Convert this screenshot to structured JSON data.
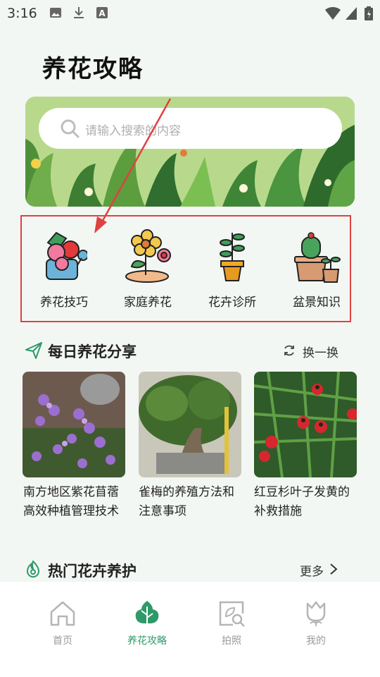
{
  "status_bar": {
    "time": "3:16"
  },
  "page_title": "养花攻略",
  "search": {
    "placeholder": "请输入搜索的内容"
  },
  "categories": [
    {
      "label": "养花技巧",
      "icon": "watering-can-rose-icon"
    },
    {
      "label": "家庭养花",
      "icon": "flower-pot-icon"
    },
    {
      "label": "花卉诊所",
      "icon": "potted-sprout-icon"
    },
    {
      "label": "盆景知识",
      "icon": "cactus-pots-icon"
    }
  ],
  "daily_share": {
    "title": "每日养花分享",
    "refresh_label": "换一换",
    "items": [
      {
        "title": "南方地区紫花苜蓿高效种植管理技术"
      },
      {
        "title": "雀梅的养殖方法和注意事项"
      },
      {
        "title": "红豆杉叶子发黄的补救措施"
      }
    ]
  },
  "hot_care": {
    "title": "热门花卉养护",
    "more_label": "更多"
  },
  "bottom_nav": [
    {
      "label": "首页",
      "icon": "home-icon",
      "active": false
    },
    {
      "label": "养花攻略",
      "icon": "leaf-tree-icon",
      "active": true
    },
    {
      "label": "拍照",
      "icon": "camera-search-icon",
      "active": false
    },
    {
      "label": "我的",
      "icon": "tulip-profile-icon",
      "active": false
    }
  ],
  "colors": {
    "accent": "#2e9a6a",
    "highlight_box": "#e04141",
    "annotation_arrow": "#e04141"
  }
}
